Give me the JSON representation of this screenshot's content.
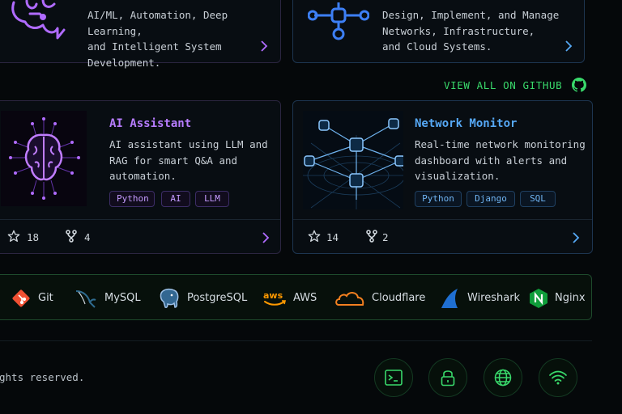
{
  "services": [
    {
      "description_lines": [
        "AI/ML, Automation, Deep Learning,",
        "and Intelligent System",
        "Development."
      ]
    },
    {
      "description_lines": [
        "Design, Implement, and Manage",
        "Networks, Infrastructure,",
        "and Cloud Systems."
      ]
    }
  ],
  "view_all_label": "VIEW ALL ON GITHUB",
  "projects": [
    {
      "title": "AI Assistant",
      "description_lines": [
        "AI assistant using LLM and",
        "RAG for smart Q&A and",
        "automation."
      ],
      "tags": [
        "Python",
        "AI",
        "LLM"
      ],
      "stars": "18",
      "forks": "4"
    },
    {
      "title": "Network Monitor",
      "description_lines": [
        "Real-time network monitoring",
        "dashboard with alerts and",
        "visualization."
      ],
      "tags": [
        "Python",
        "Django",
        "SQL"
      ],
      "stars": "14",
      "forks": "2"
    }
  ],
  "tech_stack": [
    {
      "name": "Git",
      "icon": "git-icon",
      "color": "#f05033"
    },
    {
      "name": "MySQL",
      "icon": "mysql-dolphin-icon",
      "color": "#2f6b8f"
    },
    {
      "name": "PostgreSQL",
      "icon": "postgresql-elephant-icon",
      "color": "#3a76c4"
    },
    {
      "name": "AWS",
      "icon": "aws-icon",
      "color": "#ff9900"
    },
    {
      "name": "Cloudflare",
      "icon": "cloud-icon",
      "color": "#f38020"
    },
    {
      "name": "Wireshark",
      "icon": "wireshark-fin-icon",
      "color": "#1f6fd1"
    },
    {
      "name": "Nginx",
      "icon": "nginx-icon",
      "color": "#0f9d3a"
    }
  ],
  "footer": {
    "copyright_fragment": "ghts reserved.",
    "social_icons": [
      "terminal-icon",
      "lock-icon",
      "globe-icon",
      "wifi-icon"
    ]
  },
  "colors": {
    "purple_accent": "#b77cff",
    "blue_accent": "#56a8f5",
    "green_accent": "#39d96b",
    "background": "#05080a"
  }
}
